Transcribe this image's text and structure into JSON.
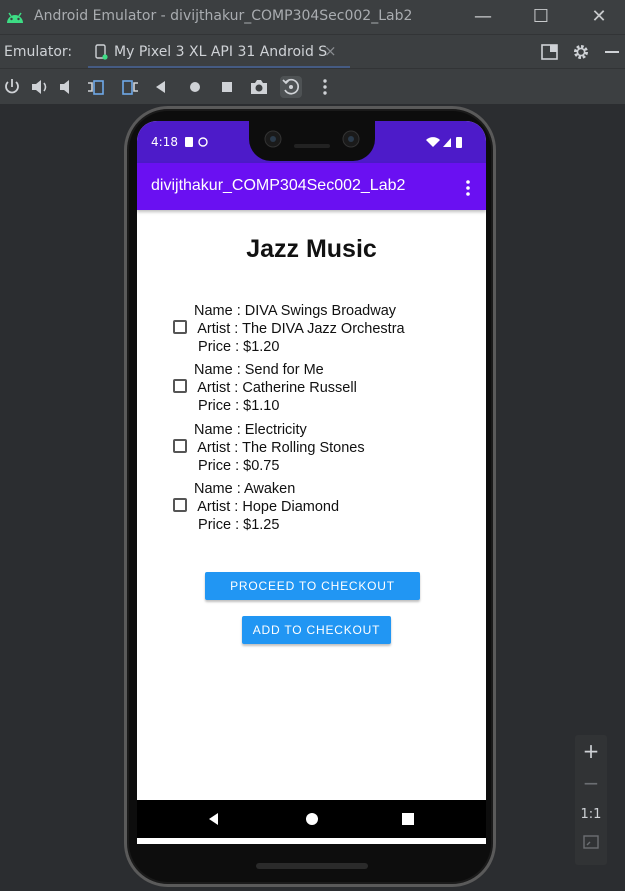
{
  "window": {
    "title": "Android Emulator - divijthakur_COMP304Sec002_Lab2",
    "controls": {
      "minimize": "—",
      "maximize": "☐",
      "close": "✕"
    }
  },
  "tabbar": {
    "prefix": "Emulator:",
    "device_tab": "My Pixel 3 XL API 31 Android S",
    "close": "×"
  },
  "zoom": {
    "plus": "+",
    "minus": "−",
    "one_to_one": "1:1"
  },
  "device": {
    "status_time": "4:18",
    "app_title": "divijthakur_COMP304Sec002_Lab2",
    "colors": {
      "status": "#4d1bc9",
      "appbar": "#6a10f2",
      "button": "#2196f3"
    }
  },
  "page": {
    "title": "Jazz Music",
    "albums": [
      {
        "name": "Name : DIVA Swings Broadway",
        "artist": " Artist : The DIVA Jazz Orchestra",
        "price": " Price : $1.20"
      },
      {
        "name": "Name : Send for Me",
        "artist": " Artist : Catherine Russell",
        "price": " Price : $1.10"
      },
      {
        "name": "Name : Electricity",
        "artist": " Artist : The Rolling Stones",
        "price": " Price : $0.75"
      },
      {
        "name": "Name : Awaken",
        "artist": " Artist : Hope Diamond",
        "price": " Price : $1.25"
      }
    ],
    "proceed_button": "PROCEED TO CHECKOUT",
    "add_button": "ADD TO CHECKOUT"
  }
}
